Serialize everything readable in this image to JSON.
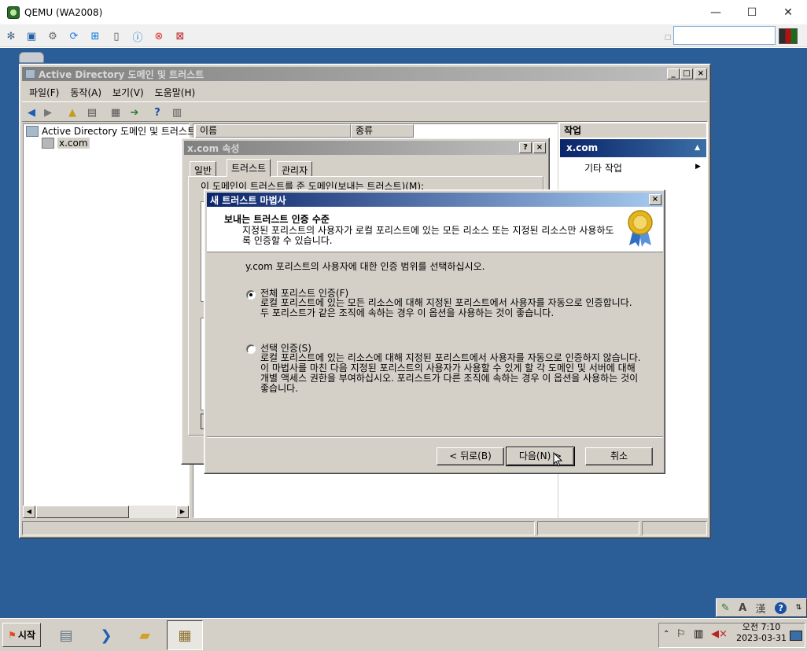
{
  "host": {
    "title": "QEMU (WA2008)",
    "minimize": "—",
    "maximize": "☐",
    "close": "✕"
  },
  "mmc": {
    "title": "Active Directory 도메인 및 트러스트",
    "menu": [
      "파일(F)",
      "동작(A)",
      "보기(V)",
      "도움말(H)"
    ],
    "tree_root": "Active Directory 도메인 및 트러스트",
    "tree_child": "x.com",
    "columns": [
      "이름",
      "종류"
    ],
    "actions_header": "작업",
    "actions_band": "x.com",
    "actions_item": "기타 작업"
  },
  "props": {
    "title": "x.com 속성",
    "tabs": [
      "일반",
      "트러스트",
      "관리자"
    ],
    "outgoing_label": "이 도메인이 트러스트를 준 도메인(보내는 트러스트)(M):"
  },
  "wizard": {
    "title": "새 트러스트 마법사",
    "header_title": "보내는 트러스트 인증 수준",
    "header_subtitle": "지정된 포리스트의 사용자가 로컬 포리스트에 있는 모든 리소스 또는 지정된 리소스만 사용하도록 인증할 수 있습니다.",
    "prompt": "y.com 포리스트의 사용자에 대한 인증 범위를 선택하십시오.",
    "options": [
      {
        "label": "전체 포리스트 인증(F)",
        "desc": "로컬 포리스트에 있는 모든 리소스에 대해 지정된 포리스트에서 사용자를 자동으로 인증합니다. 두 포리스트가 같은 조직에 속하는 경우 이 옵션을 사용하는 것이 좋습니다.",
        "checked": true
      },
      {
        "label": "선택 인증(S)",
        "desc": "로컬 포리스트에 있는 리소스에 대해 지정된 포리스트에서 사용자를 자동으로 인증하지 않습니다. 이 마법사를 마친 다음 지정된 포리스트의 사용자가 사용할 수 있게 할 각 도메인 및 서버에 대해 개별 액세스 권한을 부여하십시오. 포리스트가 다른 조직에 속하는 경우 이 옵션을 사용하는 것이 좋습니다.",
        "checked": false
      }
    ],
    "back_button": "< 뒤로(B)",
    "next_button": "다음(N) >",
    "cancel_button": "취소"
  },
  "taskbar": {
    "start_label": "시작",
    "clock_time": "오전 7:10",
    "clock_date": "2023-03-31",
    "lang_a": "A",
    "lang_han": "漢",
    "help": "?"
  },
  "colors": {
    "desktop": "#2b5d96",
    "active_title": "#0a246a",
    "face": "#d4d0c8"
  }
}
